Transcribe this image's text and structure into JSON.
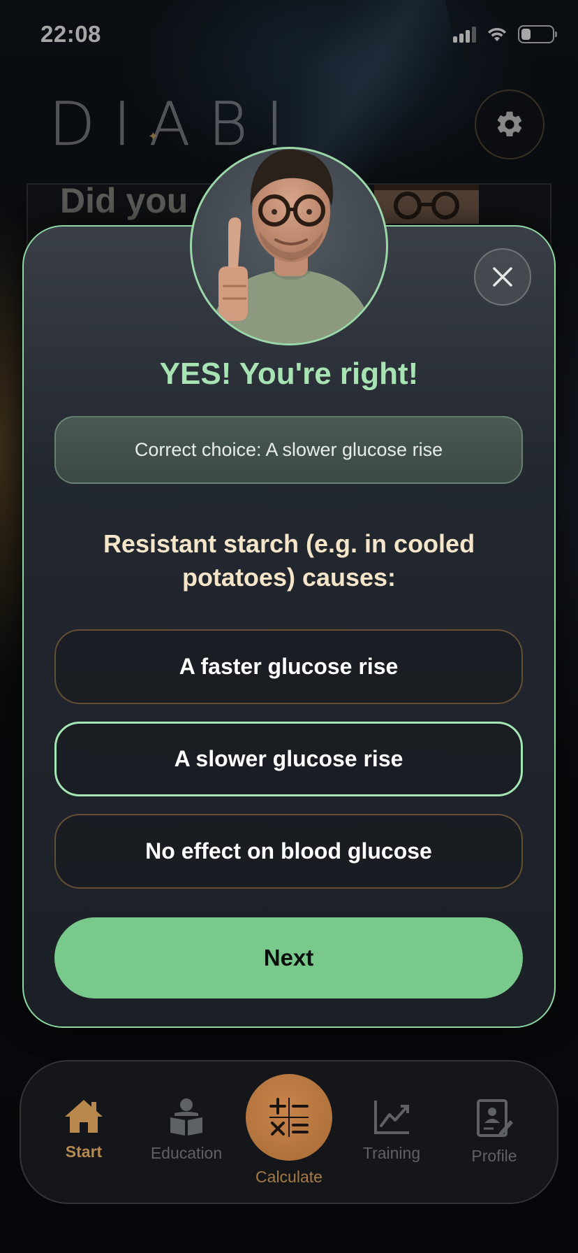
{
  "status_bar": {
    "time": "22:08",
    "battery_level": 0.3
  },
  "header": {
    "logo": "DIABI"
  },
  "background_card": {
    "title": "Did you"
  },
  "modal": {
    "result_title": "YES! You're right!",
    "correct_choice": "Correct choice: A slower glucose rise",
    "question": "Resistant starch (e.g. in cooled potatoes) causes:",
    "options": [
      {
        "label": "A faster glucose rise",
        "selected": false
      },
      {
        "label": "A slower glucose rise",
        "selected": true
      },
      {
        "label": "No effect on blood glucose",
        "selected": false
      }
    ],
    "next_label": "Next"
  },
  "nav": {
    "items": [
      {
        "label": "Start",
        "icon": "home-icon",
        "active": true
      },
      {
        "label": "Education",
        "icon": "reader-icon",
        "active": false
      },
      {
        "label": "Calculate",
        "icon": "calculator-icon",
        "active": false
      },
      {
        "label": "Training",
        "icon": "chart-line-icon",
        "active": false
      },
      {
        "label": "Profile",
        "icon": "profile-doc-icon",
        "active": false
      }
    ]
  },
  "colors": {
    "accent_green": "#79c88c",
    "title_green": "#a8e3b3",
    "accent_gold": "#b8884c",
    "question_cream": "#f6e6c9"
  }
}
